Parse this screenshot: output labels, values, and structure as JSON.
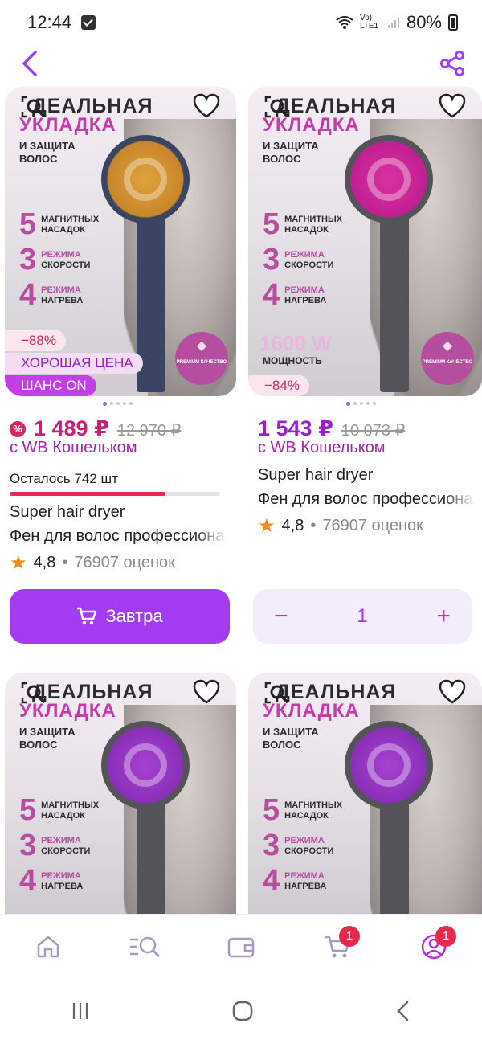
{
  "status_bar": {
    "time": "12:44",
    "network": "Vo) LTE1",
    "battery": "80%"
  },
  "top_bar": {
    "back_icon": "chevron-left-icon",
    "share_icon": "share-icon"
  },
  "products": [
    {
      "ad": {
        "headline": "ДЕАЛЬНАЯ",
        "subline": "УКЛАДКА",
        "small": "И ЗАЩИТА ВОЛОС",
        "f1_num": "5",
        "f1_text": "МАГНИТНЫХ НАСАДОК",
        "f2_num": "3",
        "f2_pink": "РЕЖИМА",
        "f2_text": "СКОРОСТИ",
        "f3_num": "4",
        "f3_pink": "РЕЖИМА",
        "f3_text": "НАГРЕВА",
        "premium": "PREMIUM КАЧЕСТВО",
        "dryer_color": "#c8862a",
        "handle_color": "#3b4462"
      },
      "discount": "−88%",
      "good_price": "ХОРОШАЯ ЦЕНА",
      "chance": "ШАНС ON",
      "price": "1 489 ₽",
      "old_price": "12 970 ₽",
      "wallet": "с WB Кошельком",
      "left_note": "Осталось 742 шт",
      "stock_fraction": 0.74,
      "title": "Super hair dryer",
      "subtitle": "Фен для волос профессиональный",
      "rating": "4,8",
      "reviews": "76907 оценок",
      "cart_label": "Завтра"
    },
    {
      "ad": {
        "headline": "ДЕАЛЬНАЯ",
        "subline": "УКЛАДКА",
        "small": "И ЗАЩИТА ВОЛОС",
        "f1_num": "5",
        "f1_text": "МАГНИТНЫХ НАСАДОК",
        "f2_num": "3",
        "f2_pink": "РЕЖИМА",
        "f2_text": "СКОРОСТИ",
        "f3_num": "4",
        "f3_pink": "РЕЖИМА",
        "f3_text": "НАГРЕВА",
        "power": "1600 W",
        "power_label": "МОЩНОСТЬ",
        "premium": "PREMIUM КАЧЕСТВО",
        "dryer_color": "#c01f93",
        "handle_color": "#55535a"
      },
      "discount": "−84%",
      "price": "1 543 ₽",
      "old_price": "10 073 ₽",
      "wallet": "с WB Кошельком",
      "title": "Super hair dryer",
      "subtitle": "Фен для волос профессиональный",
      "rating": "4,8",
      "reviews": "76907 оценок",
      "stepper": {
        "minus": "−",
        "qty": "1",
        "plus": "+"
      }
    },
    {
      "ad": {
        "headline": "ДЕАЛЬНАЯ",
        "subline": "УКЛАДКА",
        "small": "И ЗАЩИТА ВОЛОС",
        "f1_num": "5",
        "f1_text": "МАГНИТНЫХ НАСАДОК",
        "f2_num": "3",
        "f2_pink": "РЕЖИМА",
        "f2_text": "СКОРОСТИ",
        "f3_num": "4",
        "f3_pink": "РЕЖИМА",
        "f3_text": "НАГРЕВА",
        "dryer_color": "#8a2fb8",
        "handle_color": "#55535a"
      }
    },
    {
      "ad": {
        "headline": "ДЕАЛЬНАЯ",
        "subline": "УКЛАДКА",
        "small": "И ЗАЩИТА ВОЛОС",
        "f1_num": "5",
        "f1_text": "МАГНИТНЫХ НАСАДОК",
        "f2_num": "3",
        "f2_pink": "РЕЖИМА",
        "f2_text": "СКОРОСТИ",
        "f3_num": "4",
        "f3_pink": "РЕЖИМА",
        "f3_text": "НАГРЕВА",
        "dryer_color": "#8a2fb8",
        "handle_color": "#55535a"
      }
    }
  ],
  "bottom_nav": [
    {
      "icon": "home-icon"
    },
    {
      "icon": "catalog-search-icon"
    },
    {
      "icon": "wallet-icon"
    },
    {
      "icon": "cart-icon",
      "badge": "1"
    },
    {
      "icon": "profile-icon",
      "badge": "1"
    }
  ],
  "colors": {
    "accent": "#a33cf0",
    "price": "#cc1f76",
    "badge_red": "#e8284d"
  }
}
